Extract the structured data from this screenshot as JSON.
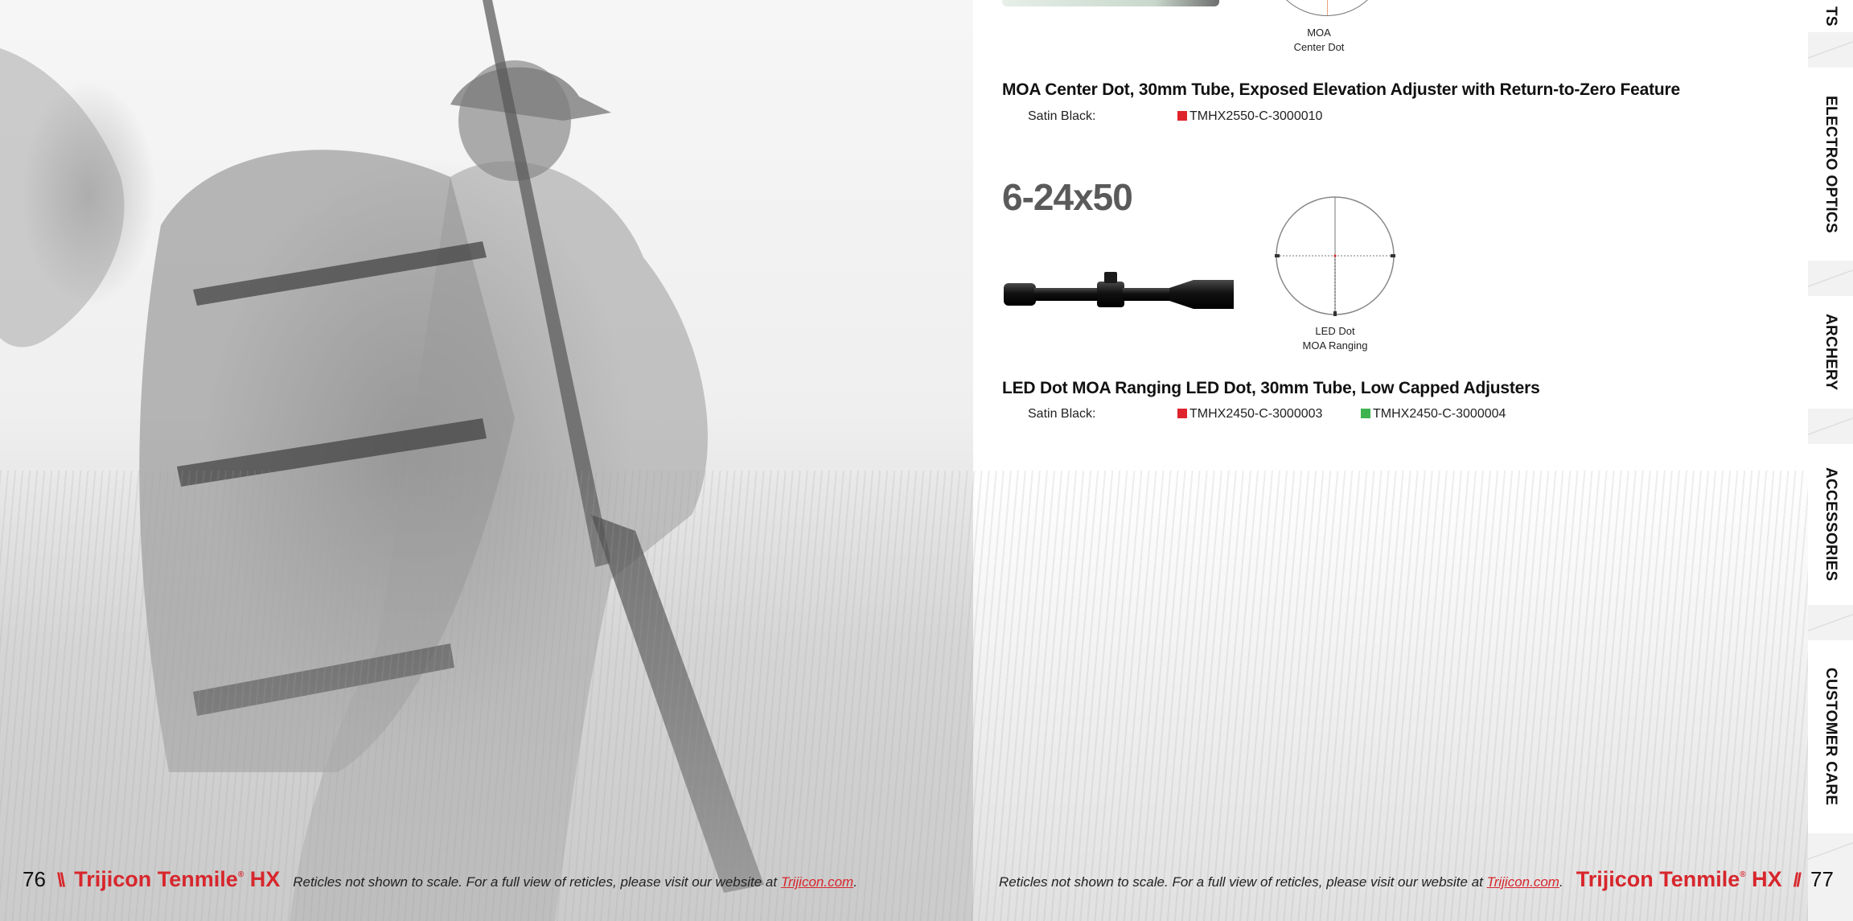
{
  "left_page": {
    "page_number": "76",
    "separator": "\\\\",
    "brand": "Trijicon Tenmile",
    "brand_mark": "®",
    "brand_suffix": "HX",
    "disclaimer_prefix": "Reticles not shown to scale. For a full view of reticles, please visit our website at ",
    "disclaimer_link": "Trijicon.com",
    "disclaimer_suffix": "."
  },
  "right_page": {
    "page_number": "77",
    "separator": "//",
    "brand": "Trijicon Tenmile",
    "brand_mark": "®",
    "brand_suffix": "HX",
    "disclaimer_prefix": "Reticles not shown to scale. For a full view of reticles, please visit our website at ",
    "disclaimer_link": "Trijicon.com",
    "disclaimer_suffix": "."
  },
  "top_product": {
    "reticle_caption_line1": "MOA",
    "reticle_caption_line2": "Center Dot",
    "title": "MOA Center Dot, 30mm Tube, Exposed Elevation Adjuster with Return-to-Zero Feature",
    "finish_label": "Satin Black:",
    "skus": [
      {
        "code": "TMHX2550-C-3000010",
        "color": "#e0242c"
      }
    ]
  },
  "section": {
    "size": "6-24x50",
    "reticle_caption_line1": "LED Dot",
    "reticle_caption_line2": "MOA Ranging",
    "title": "LED Dot MOA Ranging LED Dot, 30mm Tube, Low Capped Adjusters",
    "finish_label": "Satin Black:",
    "skus": [
      {
        "code": "TMHX2450-C-3000003",
        "color": "#e0242c"
      },
      {
        "code": "TMHX2450-C-3000004",
        "color": "#3fb34f"
      }
    ]
  },
  "tabs": [
    "ELECTRO OPTICS",
    "ARCHERY",
    "ACCESSORIES",
    "CUSTOMER CARE"
  ],
  "tab_fragment": "TS"
}
